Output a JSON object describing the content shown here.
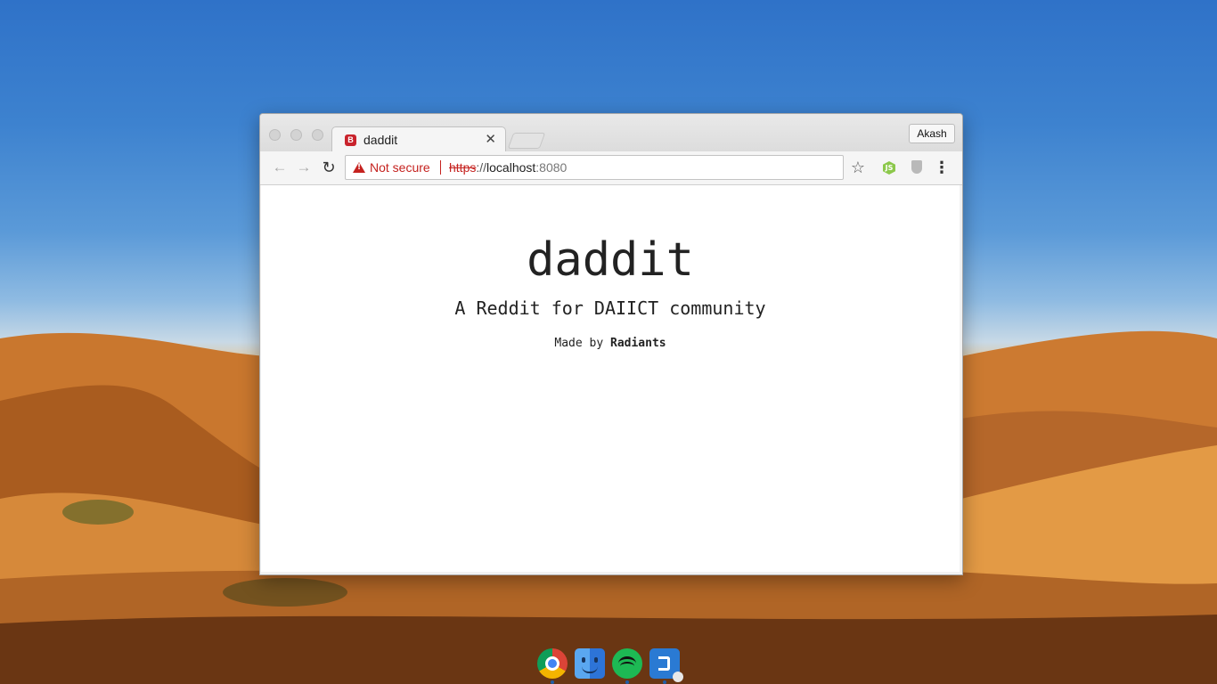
{
  "browser": {
    "tab": {
      "favicon_letter": "B",
      "title": "daddit",
      "close_symbol": "✕"
    },
    "profile_name": "Akash",
    "nav": {
      "back_symbol": "←",
      "forward_symbol": "→",
      "reload_symbol": "↻"
    },
    "omnibox": {
      "security_label": "Not secure",
      "scheme": "https",
      "separator": "://",
      "host": "localhost",
      "port": ":8080"
    },
    "toolbar_icons": {
      "star": "☆",
      "nodejs_label": "JS",
      "menu": "⋮"
    }
  },
  "page": {
    "title": "daddit",
    "subtitle": "A Reddit for DAIICT community",
    "credit_prefix": "Made by ",
    "credit_name": "Radiants"
  },
  "dock": {
    "apps": [
      "chrome",
      "finder",
      "spotify",
      "vscode"
    ]
  },
  "colors": {
    "insecure_red": "#c5221f",
    "sky_blue": "#2f72c8",
    "sand": "#c77a2e"
  }
}
